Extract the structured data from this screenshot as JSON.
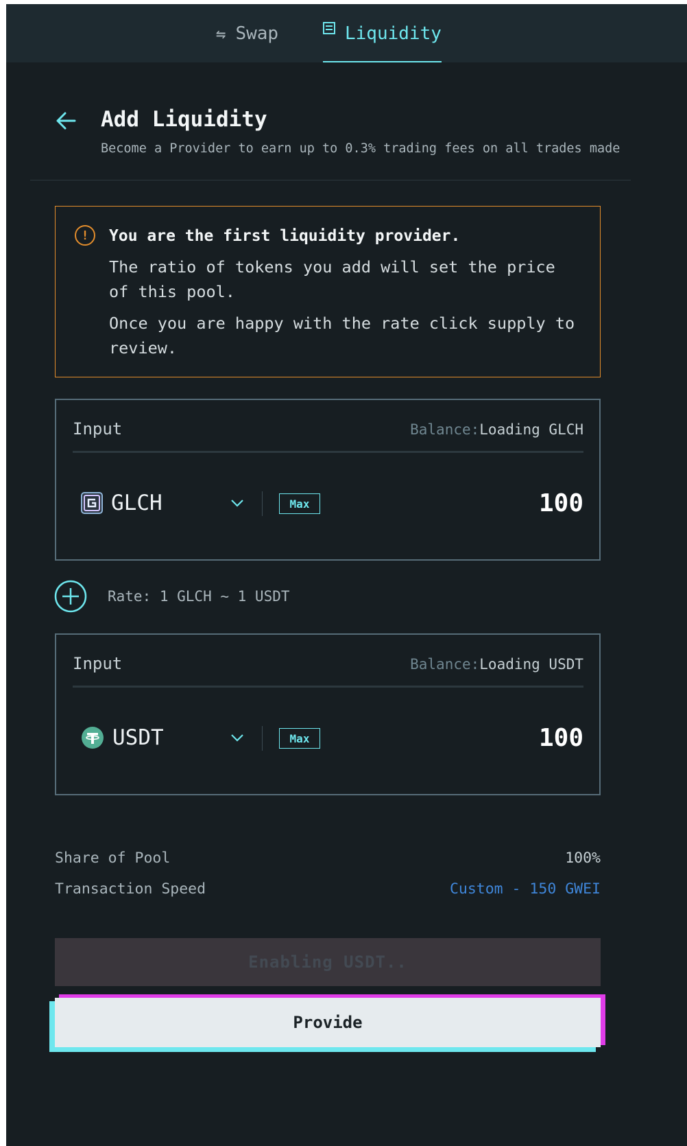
{
  "tabs": [
    {
      "label": "Swap",
      "active": false
    },
    {
      "label": "Liquidity",
      "active": true
    }
  ],
  "header": {
    "title": "Add Liquidity",
    "subtitle": "Become a Provider to earn up to 0.3% trading fees on all trades made"
  },
  "warning": {
    "title": "You are the first liquidity provider.",
    "line1": "The ratio of tokens you add will set the price of this pool.",
    "line2": "Once you are happy with the rate click supply to review."
  },
  "inputs": [
    {
      "label": "Input",
      "balance_label": "Balance:",
      "balance_value": "Loading GLCH",
      "token": "GLCH",
      "max_label": "Max",
      "amount": "100"
    },
    {
      "label": "Input",
      "balance_label": "Balance:",
      "balance_value": "Loading USDT",
      "token": "USDT",
      "max_label": "Max",
      "amount": "100"
    }
  ],
  "rate": "Rate: 1 GLCH ~ 1 USDT",
  "details": {
    "share_label": "Share of Pool",
    "share_value": "100%",
    "speed_label": "Transaction Speed",
    "speed_value": "Custom - 150 GWEI"
  },
  "buttons": {
    "enabling": "Enabling USDT..",
    "provide": "Provide"
  },
  "colors": {
    "accent": "#6ee7ee",
    "warning": "#e38d2c",
    "link": "#3f86d9",
    "pink": "#e03ce8"
  }
}
